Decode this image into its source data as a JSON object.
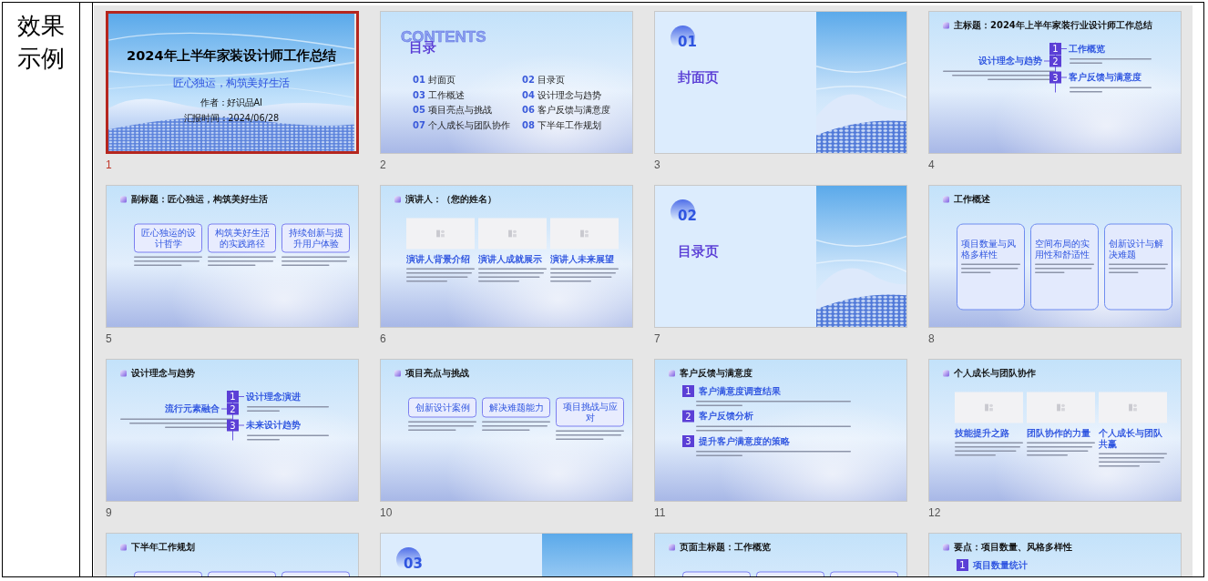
{
  "label": "效果示例",
  "slides": [
    {
      "number": "1",
      "selected": true,
      "kind": "cover",
      "title": "2024年上半年家装设计师工作总结",
      "subtitle": "匠心独运，构筑美好生活",
      "meta": [
        "作者：好识品AI",
        "汇报时间：2024/06/28"
      ]
    },
    {
      "number": "2",
      "selected": false,
      "kind": "toc",
      "watermark": "CONTENTS",
      "title": "目录",
      "items": [
        {
          "num": "01",
          "label": "封面页"
        },
        {
          "num": "02",
          "label": "目录页"
        },
        {
          "num": "03",
          "label": "工作概述"
        },
        {
          "num": "04",
          "label": "设计理念与趋势"
        },
        {
          "num": "05",
          "label": "项目亮点与挑战"
        },
        {
          "num": "06",
          "label": "客户反馈与满意度"
        },
        {
          "num": "07",
          "label": "个人成长与团队协作"
        },
        {
          "num": "08",
          "label": "下半年工作规划"
        }
      ]
    },
    {
      "number": "3",
      "selected": false,
      "kind": "section",
      "num": "01",
      "title": "封面页"
    },
    {
      "number": "4",
      "selected": false,
      "kind": "timeline",
      "title": "主标题：2024年上半年家装行业设计师工作总结",
      "left": {
        "num": "2",
        "heading": "设计理念与趋势"
      },
      "right": [
        {
          "num": "1",
          "heading": "工作概览"
        },
        {
          "num": "3",
          "heading": "客户反馈与满意度"
        }
      ]
    },
    {
      "number": "5",
      "selected": false,
      "kind": "boxes",
      "title": "副标题：匠心独运，构筑美好生活",
      "cards": [
        {
          "heading": "匠心独运的设计哲学"
        },
        {
          "heading": "构筑美好生活的实践路径"
        },
        {
          "heading": "持续创新与提升用户体验"
        }
      ]
    },
    {
      "number": "6",
      "selected": false,
      "kind": "photos",
      "title": "演讲人：（您的姓名）",
      "cards": [
        {
          "heading": "演讲人背景介绍"
        },
        {
          "heading": "演讲人成就展示"
        },
        {
          "heading": "演讲人未来展望"
        }
      ]
    },
    {
      "number": "7",
      "selected": false,
      "kind": "section",
      "num": "02",
      "title": "目录页"
    },
    {
      "number": "8",
      "selected": false,
      "kind": "tall",
      "title": "工作概述",
      "cards": [
        {
          "heading": "项目数量与风格多样性"
        },
        {
          "heading": "空间布局的实用性和舒适性"
        },
        {
          "heading": "创新设计与解决难题"
        }
      ]
    },
    {
      "number": "9",
      "selected": false,
      "kind": "timeline",
      "title": "设计理念与趋势",
      "left": {
        "num": "2",
        "heading": "流行元素融合"
      },
      "right": [
        {
          "num": "1",
          "heading": "设计理念演进"
        },
        {
          "num": "3",
          "heading": "未来设计趋势"
        }
      ]
    },
    {
      "number": "10",
      "selected": false,
      "kind": "boxes",
      "title": "项目亮点与挑战",
      "cards": [
        {
          "heading": "创新设计案例"
        },
        {
          "heading": "解决难题能力"
        },
        {
          "heading": "项目挑战与应对"
        }
      ]
    },
    {
      "number": "11",
      "selected": false,
      "kind": "list",
      "title": "客户反馈与满意度",
      "items": [
        {
          "num": "1",
          "heading": "客户满意度调查结果"
        },
        {
          "num": "2",
          "heading": "客户反馈分析"
        },
        {
          "num": "3",
          "heading": "提升客户满意度的策略"
        }
      ]
    },
    {
      "number": "12",
      "selected": false,
      "kind": "photos",
      "title": "个人成长与团队协作",
      "cards": [
        {
          "heading": "技能提升之路"
        },
        {
          "heading": "团队协作的力量"
        },
        {
          "heading": "个人成长与团队共赢"
        }
      ]
    },
    {
      "selected": false,
      "kind": "boxes",
      "title": "下半年工作规划"
    },
    {
      "selected": false,
      "kind": "section",
      "num": "03"
    },
    {
      "selected": false,
      "kind": "boxes",
      "title": "页面主标题：工作概览"
    },
    {
      "selected": false,
      "kind": "list",
      "title": "要点：项目数量、风格多样性",
      "items": [
        {
          "num": "1",
          "heading": "项目数量统计"
        }
      ]
    }
  ]
}
